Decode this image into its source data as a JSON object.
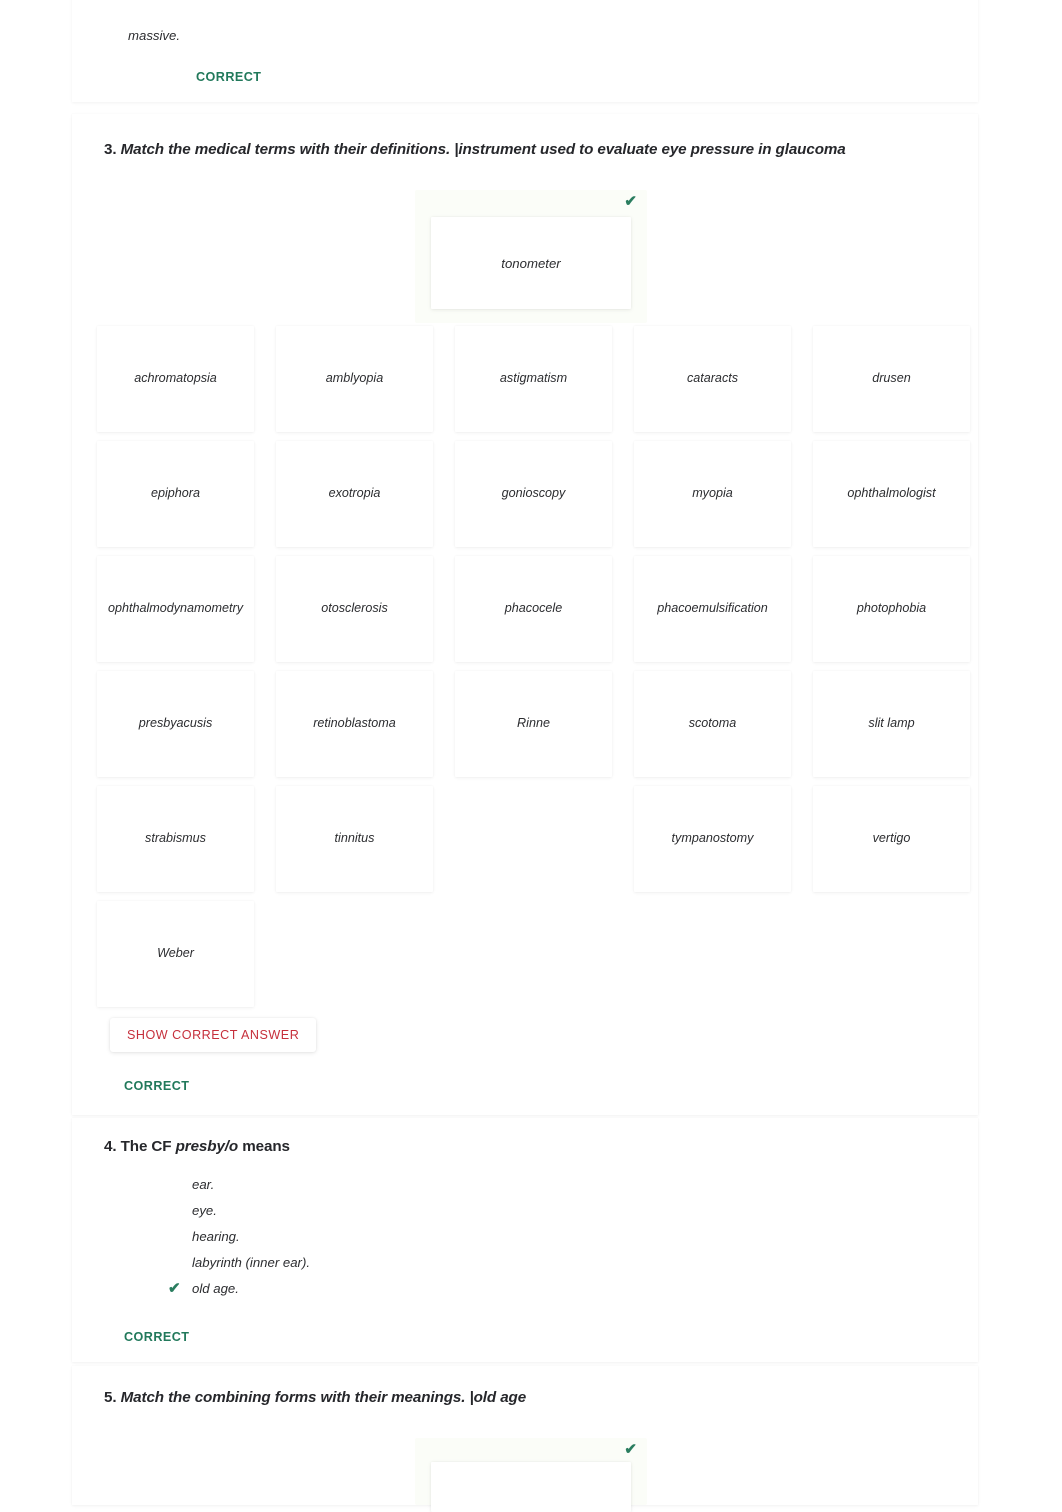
{
  "questions": [
    {
      "id": "q2-tail",
      "partial_choice": "massive.",
      "status": "CORRECT"
    },
    {
      "id": "q3",
      "number": "3.",
      "prompt": "Match the medical terms with their definitions.",
      "definition": "|instrument used to evaluate eye pressure in glaucoma",
      "answer": "tonometer",
      "answer_tick": "✔",
      "options": [
        "achromatopsia",
        "amblyopia",
        "astigmatism",
        "cataracts",
        "drusen",
        "epiphora",
        "exotropia",
        "gonioscopy",
        "myopia",
        "ophthalmologist",
        "ophthalmodynamometry",
        "otosclerosis",
        "phacocele",
        "phacoemulsification",
        "photophobia",
        "presbyacusis",
        "retinoblastoma",
        "Rinne",
        "scotoma",
        "slit lamp",
        "strabismus",
        "tinnitus",
        "",
        "tympanostomy",
        "vertigo",
        "Weber",
        "",
        "",
        "",
        ""
      ],
      "show_answer_label": "SHOW CORRECT ANSWER",
      "status": "CORRECT"
    },
    {
      "id": "q4",
      "number": "4.",
      "prompt_lead": "The CF ",
      "prompt_em": "presby/o",
      "prompt_tail": " means",
      "choices": [
        {
          "label": "ear.",
          "selected": false
        },
        {
          "label": "eye.",
          "selected": false
        },
        {
          "label": "hearing.",
          "selected": false
        },
        {
          "label": "labyrinth (inner ear).",
          "selected": false
        },
        {
          "label": "old age.",
          "selected": true
        }
      ],
      "tick": "✔",
      "status": "CORRECT"
    },
    {
      "id": "q5",
      "number": "5.",
      "prompt": "Match the combining forms with their meanings.",
      "definition": "|old age",
      "answer_tick": "✔"
    }
  ],
  "colors": {
    "correct_green": "#22795b",
    "tick_green": "#2a7d5f",
    "show_answer_red": "#c6303c",
    "text": "#2c2d30",
    "dropzone_bg": "#fbfdf8"
  }
}
